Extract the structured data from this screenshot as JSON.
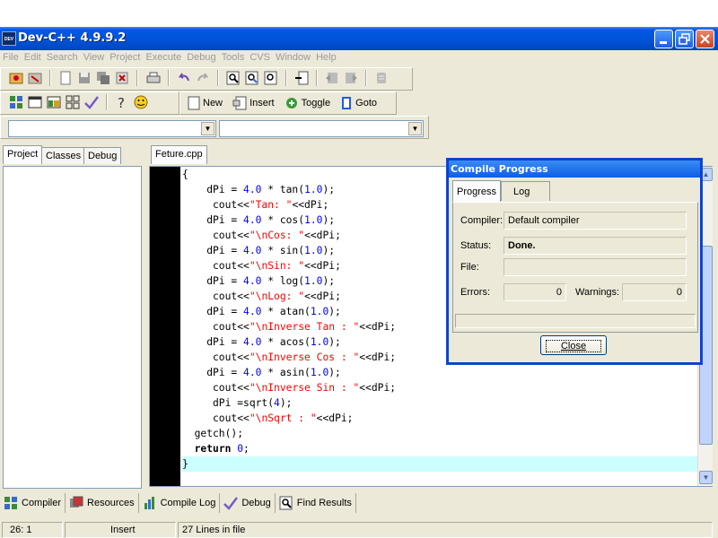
{
  "window": {
    "title": "Dev-C++ 4.9.9.2",
    "app_icon_text": "DEV"
  },
  "menu": [
    "File",
    "Edit",
    "Search",
    "View",
    "Project",
    "Execute",
    "Debug",
    "Tools",
    "CVS",
    "Window",
    "Help"
  ],
  "toolbar": {
    "new_label": "New",
    "insert_label": "Insert",
    "toggle_label": "Toggle",
    "goto_label": "Goto"
  },
  "left_panel": {
    "tabs": [
      "Project",
      "Classes",
      "Debug"
    ]
  },
  "editor": {
    "file_tab": "Feture.cpp"
  },
  "code_lines": [
    "{",
    "    dPi = 4.0 * tan(1.0);",
    "     cout<<\"Tan: \"<<dPi;",
    "    dPi = 4.0 * cos(1.0);",
    "     cout<<\"\\nCos: \"<<dPi;",
    "    dPi = 4.0 * sin(1.0);",
    "     cout<<\"\\nSin: \"<<dPi;",
    "    dPi = 4.0 * log(1.0);",
    "     cout<<\"\\nLog: \"<<dPi;",
    "    dPi = 4.0 * atan(1.0);",
    "     cout<<\"\\nInverse Tan : \"<<dPi;",
    "    dPi = 4.0 * acos(1.0);",
    "     cout<<\"\\nInverse Cos : \"<<dPi;",
    "    dPi = 4.0 * asin(1.0);",
    "     cout<<\"\\nInverse Sin : \"<<dPi;",
    "     dPi =sqrt(4);",
    "     cout<<\"\\nSqrt : \"<<dPi;",
    "  getch();",
    "  return 0;",
    "}"
  ],
  "compile_dialog": {
    "title": "Compile Progress",
    "tabs": [
      "Progress",
      "Log"
    ],
    "compiler_label": "Compiler:",
    "compiler_value": "Default compiler",
    "status_label": "Status:",
    "status_value": "Done.",
    "file_label": "File:",
    "file_value": "",
    "errors_label": "Errors:",
    "errors_value": "0",
    "warnings_label": "Warnings:",
    "warnings_value": "0",
    "close_label": "Close"
  },
  "bottom_tabs": [
    "Compiler",
    "Resources",
    "Compile Log",
    "Debug",
    "Find Results"
  ],
  "status": {
    "position": "26: 1",
    "mode": "Insert",
    "lines": "27 Lines in file"
  }
}
